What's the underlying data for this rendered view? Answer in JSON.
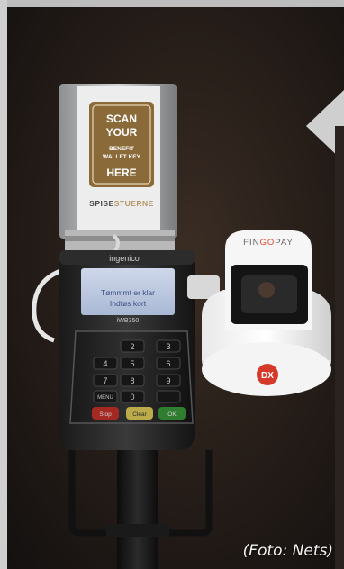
{
  "stand_card": {
    "lines": [
      "SCAN",
      "YOUR",
      "BENEFIT",
      "WALLET KEY",
      "HERE"
    ],
    "brand_a": "SPISE",
    "brand_b": "STUERNE"
  },
  "terminal": {
    "brand": "ingenico",
    "screen_line1": "Tømmmt er klar",
    "screen_line2": "Indføs kort",
    "model": "iWB350",
    "keys": {
      "k2": "2",
      "k3": "3",
      "k4": "4",
      "k5": "5",
      "k6": "6",
      "k7": "7",
      "k8": "8",
      "k9": "9",
      "menu": "MENU",
      "k0": "0",
      "stop": "Stop",
      "clear": "Clear",
      "ok": "OK"
    }
  },
  "fingopay": {
    "label_a": "FIN",
    "label_b": "GO",
    "label_c": "PAY",
    "logo": "DX"
  },
  "caption": "(Foto: Nets)",
  "colors": {
    "card_brown": "#8b6a3a",
    "stop_red": "#c8322a",
    "clear_yellow": "#e5d15b",
    "ok_green": "#3a9a3a",
    "fingopay_orange": "#e8452e",
    "logo_red": "#d6392a"
  }
}
